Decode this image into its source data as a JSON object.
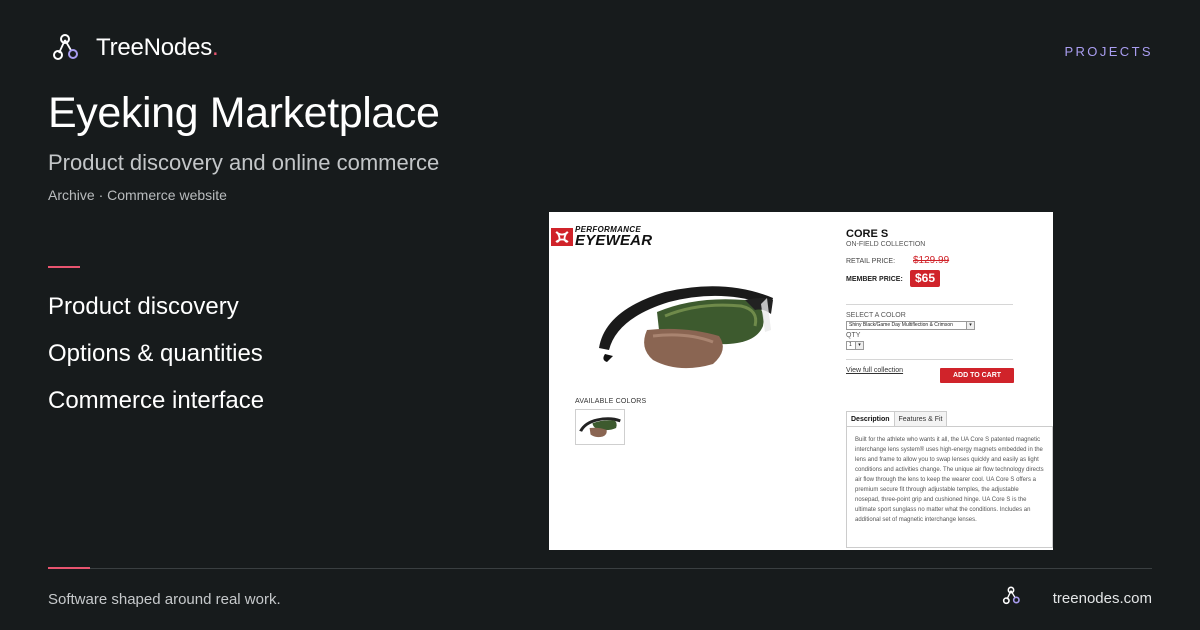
{
  "brand": {
    "name": "TreeNodes",
    "dot": "."
  },
  "nav": {
    "projects": "PROJECTS"
  },
  "page": {
    "title": "Eyeking Marketplace",
    "subtitle": "Product discovery and online commerce",
    "meta": "Archive · Commerce website"
  },
  "features": [
    "Product discovery",
    "Options & quantities",
    "Commerce interface"
  ],
  "footer": {
    "tagline": "Software shaped around real work.",
    "url": "treenodes.com"
  },
  "colors": {
    "background": "#171b1c",
    "accent": "#e8546f",
    "nav": "#a99df0",
    "ua_red": "#d0232a"
  },
  "screenshot": {
    "logo": {
      "line1": "PERFORMANCE",
      "line2": "EYEWEAR"
    },
    "product": {
      "name": "CORE S",
      "collection": "ON-FIELD COLLECTION",
      "retail_label": "RETAIL PRICE:",
      "retail_price": "$129.99",
      "member_label": "MEMBER PRICE:",
      "member_price": "$65"
    },
    "color_label": "SELECT A COLOR",
    "color_value": "Shiny Black/Game Day Multiflection & Crimson",
    "qty_label": "QTY",
    "qty_value": "1",
    "view_link": "View full collection",
    "cart_button": "ADD TO CART",
    "available_colors": "AVAILABLE COLORS",
    "tabs": [
      "Description",
      "Features & Fit"
    ],
    "description": "Built for the athlete who wants it all, the UA Core S patented magnetic interchange lens system® uses high-energy magnets embedded in the lens and frame to allow you to swap lenses quickly and easily as light conditions and activities change. The unique air flow technology directs air flow through the lens to keep the wearer cool. UA Core S offers a premium secure fit through adjustable temples, the adjustable nosepad, three-point grip and cushioned hinge. UA Core S is the ultimate sport sunglass no matter what the conditions. Includes an additional set of magnetic interchange lenses."
  }
}
